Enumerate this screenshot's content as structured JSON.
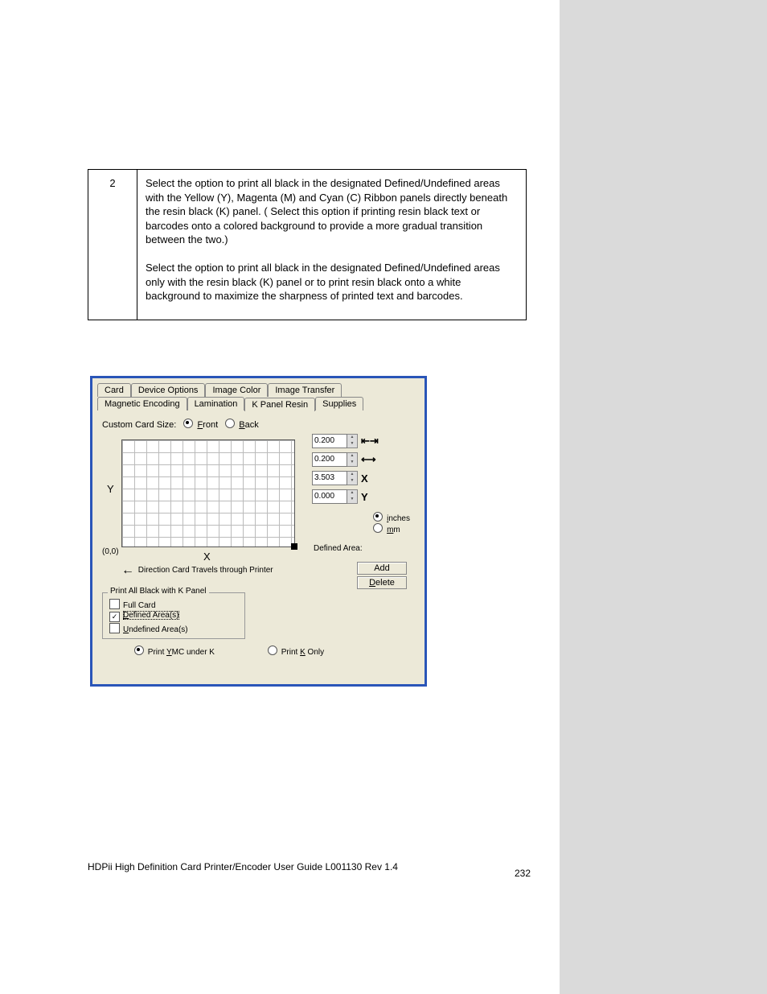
{
  "instruction": {
    "step": "2",
    "para1_a": "Select the ",
    "para1_b": " option to print all black in the designated Defined/Undefined areas with the Yellow (Y), Magenta (M) and Cyan (C) Ribbon panels directly beneath the resin black (K) panel. (",
    "para1_c": " Select this option if printing resin black text or barcodes onto a colored background to provide a more gradual transition between the two.)",
    "para2_a": "Select the ",
    "para2_b": " option to print all black in the designated Defined/Undefined areas only with the resin black (K) panel or to print resin black onto a white background to maximize the sharpness of printed text and barcodes."
  },
  "dialog": {
    "tabs_top": [
      "Card",
      "Device Options",
      "Image Color",
      "Image Transfer"
    ],
    "tabs_bottom": [
      "Magnetic Encoding",
      "Lamination",
      "K Panel Resin",
      "Supplies"
    ],
    "active_tab": "K Panel Resin",
    "custom_size_label": "Custom Card Size:",
    "radio_front": "Front",
    "radio_back": "Back",
    "y_axis": "Y",
    "x_axis": "X",
    "origin": "(0,0)",
    "direction": "Direction Card Travels through Printer",
    "spinners": [
      {
        "value": "0.200",
        "icon": "↔"
      },
      {
        "value": "0.200",
        "icon": "↕"
      },
      {
        "value": "3.503",
        "icon": "X"
      },
      {
        "value": "0.000",
        "icon": "Y"
      }
    ],
    "unit_inches": "inches",
    "unit_mm": "mm",
    "defined_area_label": "Defined Area:",
    "btn_add": "Add",
    "btn_delete": "Delete",
    "kpanel_legend": "Print All Black with K Panel",
    "kpanel_full": "Full Card",
    "kpanel_defined": "Defined Area(s)",
    "kpanel_undefined": "Undefined Area(s)",
    "radio_ymc": "Print YMC under K",
    "radio_konly": "Print K Only"
  },
  "footer": {
    "left": "HDPii High Definition Card Printer/Encoder User Guide    L001130 Rev 1.4",
    "page": "232"
  }
}
